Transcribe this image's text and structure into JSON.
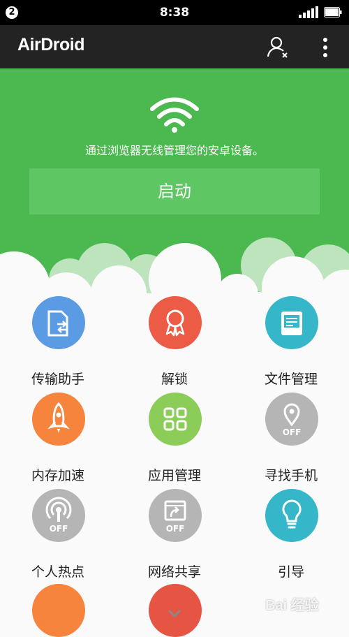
{
  "status_bar": {
    "notification_count": "2",
    "time": "8:38",
    "signal_icon": "signal-bars-icon",
    "battery_icon": "battery-icon"
  },
  "app_bar": {
    "title": "AirDroid",
    "account_icon": "user-account-icon",
    "menu_icon": "more-vertical-icon"
  },
  "hero": {
    "icon": "wifi-icon",
    "tagline": "通过浏览器无线管理您的安卓设备。",
    "start_button": "启动",
    "colors": {
      "background": "#4bb94f",
      "button": "#5fc664"
    }
  },
  "features": [
    {
      "label": "传输助手",
      "icon": "file-transfer-icon",
      "color": "#5a9be4"
    },
    {
      "label": "解锁",
      "icon": "award-badge-icon",
      "color": "#ec5b46"
    },
    {
      "label": "文件管理",
      "icon": "file-manager-icon",
      "color": "#35b6c9"
    },
    {
      "label": "内存加速",
      "icon": "rocket-icon",
      "color": "#f6843d"
    },
    {
      "label": "应用管理",
      "icon": "app-grid-icon",
      "color": "#8ccc59"
    },
    {
      "label": "寻找手机",
      "icon": "location-pin-icon",
      "color": "#b5b5b5",
      "state": "OFF"
    },
    {
      "label": "个人热点",
      "icon": "hotspot-icon",
      "color": "#b5b5b5",
      "state": "OFF"
    },
    {
      "label": "网络共享",
      "icon": "screen-share-icon",
      "color": "#b5b5b5",
      "state": "OFF"
    },
    {
      "label": "引导",
      "icon": "lightbulb-icon",
      "color": "#35b6c9"
    }
  ],
  "more_indicator_icon": "chevron-down-icon",
  "watermark": {
    "text": "Bai 经验"
  }
}
